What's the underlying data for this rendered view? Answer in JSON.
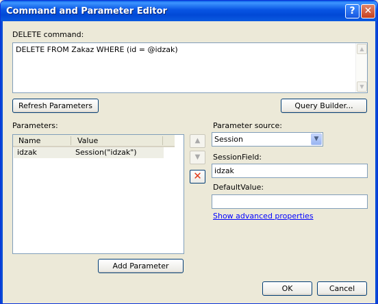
{
  "window": {
    "title": "Command and Parameter Editor",
    "help_label": "?",
    "close_label": "✕"
  },
  "command": {
    "label": "DELETE command:",
    "text": "DELETE FROM Zakaz WHERE (id = @idzak)"
  },
  "buttons": {
    "refresh": "Refresh Parameters",
    "query_builder": "Query Builder...",
    "add_parameter": "Add Parameter",
    "ok": "OK",
    "cancel": "Cancel"
  },
  "parameters": {
    "label": "Parameters:",
    "columns": [
      "Name",
      "Value"
    ],
    "rows": [
      {
        "name": "idzak",
        "value": "Session(\"idzak\")"
      }
    ]
  },
  "side_buttons": {
    "up_icon": "up-arrow",
    "down_icon": "down-arrow",
    "delete_icon": "red-x",
    "delete_color": "#e03a1a"
  },
  "parameter_source": {
    "label": "Parameter source:",
    "value": "Session"
  },
  "session_field": {
    "label": "SessionField:",
    "value": "idzak"
  },
  "default_value": {
    "label": "DefaultValue:",
    "value": ""
  },
  "advanced_link": "Show advanced properties"
}
